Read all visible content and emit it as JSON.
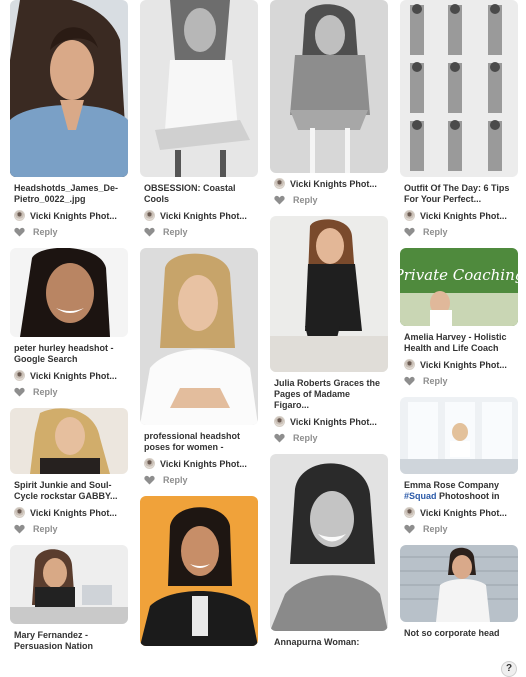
{
  "pins": {
    "p1": {
      "desc": "Headshotds_James_De-Pietro_0022_.jpg",
      "board": "Vicki Knights Phot...",
      "reply": "Reply"
    },
    "p2": {
      "desc": "OBSESSION: Coastal Cools",
      "board": "Vicki Knights Phot...",
      "reply": "Reply"
    },
    "p3": {
      "board": "Vicki Knights Phot...",
      "reply": "Reply"
    },
    "p4": {
      "desc": "Outfit Of The Day: 6 Tips For Your Perfect...",
      "board": "Vicki Knights Phot...",
      "reply": "Reply"
    },
    "p5": {
      "desc": "peter hurley headshot - Google Search",
      "board": "Vicki Knights Phot...",
      "reply": "Reply"
    },
    "p6": {
      "desc": "professional headshot poses for women - Google...",
      "board": "Vicki Knights Phot...",
      "reply": "Reply"
    },
    "p7": {
      "desc": "Julia Roberts Graces the Pages of Madame Figaro...",
      "board": "Vicki Knights Phot...",
      "reply": "Reply"
    },
    "p8": {
      "desc": "Amelia Harvey - Holistic Health and Life Coach",
      "board": "Vicki Knights Phot...",
      "reply": "Reply",
      "image_text": "Private Coaching"
    },
    "p9": {
      "desc": "Spirit Junkie and Soul-Cycle rockstar GABBY...",
      "board": "Vicki Knights Phot...",
      "reply": "Reply"
    },
    "p10": {
      "desc_pre": "Emma Rose Company ",
      "desc_hash": "#Squad",
      "desc_post": " Photoshoot in Seattle",
      "board": "Vicki Knights Phot...",
      "reply": "Reply"
    },
    "p11": {
      "desc": "Mary Fernandez - Persuasion Nation"
    },
    "p12": {
      "desc": "Annapurna Woman:"
    },
    "p13": {
      "desc": "Not so corporate head"
    },
    "p14": {}
  },
  "help_label": "?",
  "colors": {
    "link": "#2b5aa8",
    "muted": "#8e8e8e",
    "text": "#333333"
  }
}
